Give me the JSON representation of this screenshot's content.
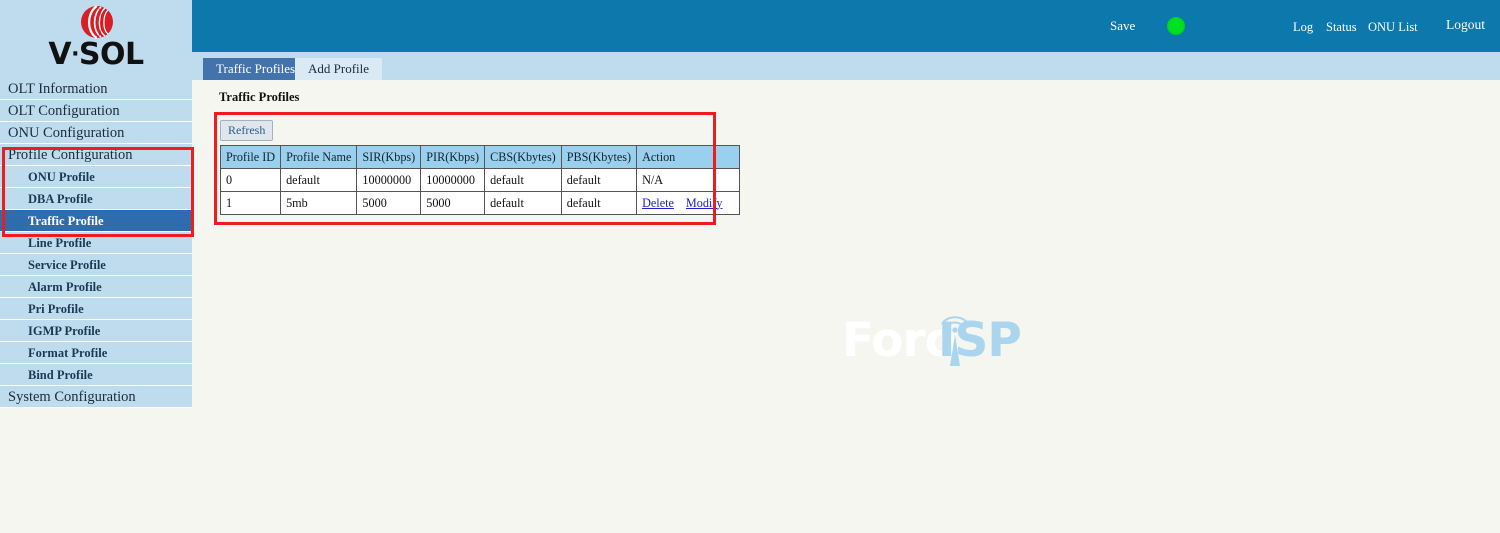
{
  "brand": {
    "name": "V·SOL",
    "name_part1": "V",
    "name_dot": "·",
    "name_part2": "SOL",
    "logo_icon": "vsol-sphere-logo",
    "logo_color": "#d61f26"
  },
  "header": {
    "save_label": "Save",
    "status_led": "green-status-indicator",
    "status_led_color": "#00e024",
    "links": [
      {
        "label": "Log"
      },
      {
        "label": "Status"
      },
      {
        "label": "ONU List"
      }
    ],
    "logout_label": "Logout",
    "background_color": "#0c78ab"
  },
  "sidebar": {
    "background_color": "#bfdcef",
    "active_color": "#2f6cad",
    "items": [
      {
        "label": "OLT Information",
        "level": "top",
        "active": false
      },
      {
        "label": "OLT Configuration",
        "level": "top",
        "active": false
      },
      {
        "label": "ONU Configuration",
        "level": "top",
        "active": false
      },
      {
        "label": "Profile Configuration",
        "level": "top",
        "active": false
      },
      {
        "label": "ONU Profile",
        "level": "sub",
        "active": false
      },
      {
        "label": "DBA Profile",
        "level": "sub",
        "active": false
      },
      {
        "label": "Traffic Profile",
        "level": "sub",
        "active": true
      },
      {
        "label": "Line Profile",
        "level": "sub",
        "active": false
      },
      {
        "label": "Service Profile",
        "level": "sub",
        "active": false
      },
      {
        "label": "Alarm Profile",
        "level": "sub",
        "active": false
      },
      {
        "label": "Pri Profile",
        "level": "sub",
        "active": false
      },
      {
        "label": "IGMP Profile",
        "level": "sub",
        "active": false
      },
      {
        "label": "Format Profile",
        "level": "sub",
        "active": false
      },
      {
        "label": "Bind Profile",
        "level": "sub",
        "active": false
      },
      {
        "label": "System Configuration",
        "level": "top",
        "active": false
      }
    ]
  },
  "tabs": [
    {
      "label": "Traffic Profiles",
      "active": true
    },
    {
      "label": "Add Profile",
      "active": false
    }
  ],
  "main": {
    "page_title": "Traffic Profiles",
    "refresh_label": "Refresh",
    "table": {
      "columns": [
        "Profile ID",
        "Profile Name",
        "SIR(Kbps)",
        "PIR(Kbps)",
        "CBS(Kbytes)",
        "PBS(Kbytes)",
        "Action"
      ],
      "rows": [
        {
          "profile_id": "0",
          "profile_name": "default",
          "sir": "10000000",
          "pir": "10000000",
          "cbs": "default",
          "pbs": "default",
          "action_text": "N/A",
          "has_links": false,
          "delete_label": "",
          "modify_label": ""
        },
        {
          "profile_id": "1",
          "profile_name": "5mb",
          "sir": "5000",
          "pir": "5000",
          "cbs": "default",
          "pbs": "default",
          "action_text": "",
          "has_links": true,
          "delete_label": "Delete",
          "modify_label": "Modify"
        }
      ]
    }
  },
  "annotations": {
    "highlight_color": "#ee1c1c",
    "sidebar_box": "red-highlight-sidebar-profile-group",
    "panel_box": "red-highlight-traffic-profiles-table"
  },
  "watermark": {
    "text_light": "Foro",
    "text_accent": "ISP",
    "icon": "radio-tower-icon",
    "accent_color": "#a9d5ef"
  }
}
